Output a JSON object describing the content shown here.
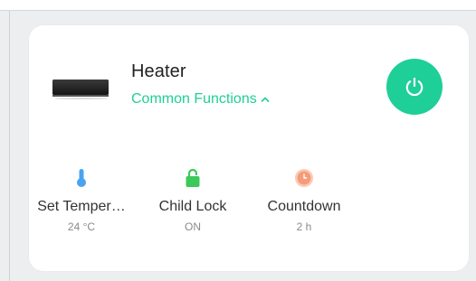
{
  "device": {
    "name": "Heater",
    "common_functions_label": "Common Functions"
  },
  "functions": [
    {
      "label": "Set Temper…",
      "value": "24 °C",
      "icon": "thermometer-icon",
      "color": "#4aa3f0"
    },
    {
      "label": "Child Lock",
      "value": "ON",
      "icon": "lock-icon",
      "color": "#3cc95a"
    },
    {
      "label": "Countdown",
      "value": "2 h",
      "icon": "timer-icon",
      "color": "#f59b7a"
    }
  ],
  "colors": {
    "accent": "#1ecf97",
    "text": "#222222",
    "subtext": "#8a8a8a"
  }
}
